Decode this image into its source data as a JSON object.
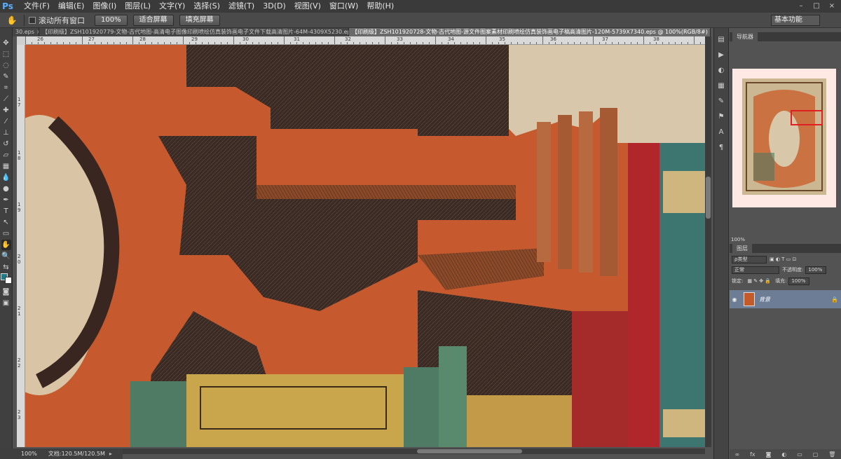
{
  "app": {
    "logo": "Ps"
  },
  "menu": [
    "文件(F)",
    "编辑(E)",
    "图像(I)",
    "图层(L)",
    "文字(Y)",
    "选择(S)",
    "滤镜(T)",
    "3D(D)",
    "视图(V)",
    "窗口(W)",
    "帮助(H)"
  ],
  "window_controls": [
    "–",
    "□",
    "×"
  ],
  "options": {
    "scroll_all_label": "滚动所有窗口",
    "zoom_btn": "100%",
    "fit_screen_btn": "适合屏幕",
    "fill_screen_btn": "填充屏幕",
    "workspace": "基本功能"
  },
  "tabs": [
    {
      "label": "30.eps",
      "active": false
    },
    {
      "label": "【印刷级】ZSH101920779-文物-古代地图-高清电子图像印刷喷绘仿真装饰画电子文件下载高清图片-64M-4309X5230.eps",
      "active": false
    },
    {
      "label": "【印刷级】ZSH101920728-文物-古代地图-源文件图案素材印刷喷绘仿真装饰画电子稿高清图片-120M-5739X7340.eps @ 100%(RGB/8#)",
      "active": true
    }
  ],
  "ruler": {
    "top_labels": [
      "26",
      "27",
      "28",
      "29",
      "30",
      "31",
      "32",
      "33",
      "34",
      "35",
      "36",
      "37",
      "38"
    ],
    "left_labels": [
      "1",
      "7",
      "1",
      "8",
      "1",
      "9",
      "2",
      "0",
      "2",
      "1",
      "2",
      "2",
      "2",
      "3"
    ]
  },
  "status": {
    "zoom": "100%",
    "doc": "文档:120.5M/120.5M"
  },
  "navigator": {
    "tab": "导航器",
    "zoom": "100%"
  },
  "layers": {
    "tab": "图层",
    "kind_filter": "ρ类型",
    "blend_mode": "正常",
    "opacity_label": "不透明度:",
    "opacity": "100%",
    "lock_label": "锁定:",
    "fill_label": "填充:",
    "fill": "100%",
    "layer_name": "背景"
  },
  "colors": {
    "foreground": "#1f7a8a",
    "background": "#ffffff"
  }
}
